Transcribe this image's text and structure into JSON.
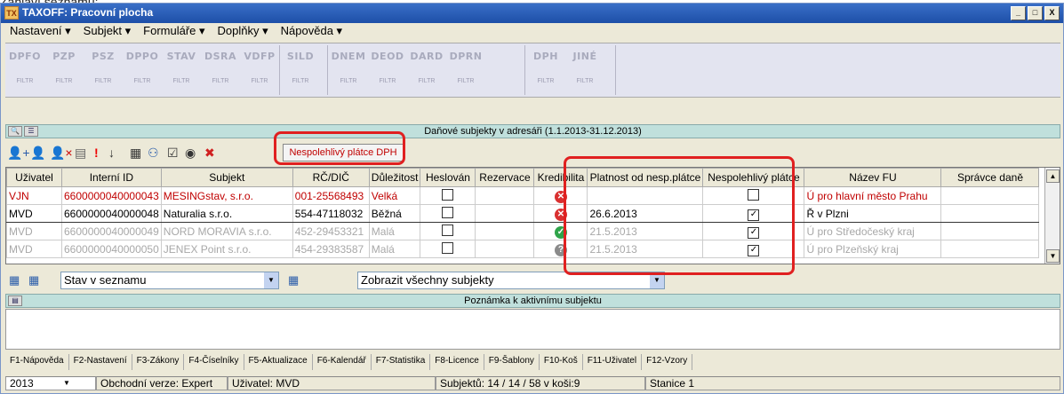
{
  "caption": "Zahlaví seznamu:",
  "window": {
    "title": "TAXOFF: Pracovní plocha",
    "icon": "app-icon",
    "buttons": [
      "_",
      "□",
      "X"
    ]
  },
  "menu": [
    {
      "label": "Nastavení ▾"
    },
    {
      "label": "Subjekt ▾"
    },
    {
      "label": "Formuláře ▾"
    },
    {
      "label": "Doplňky ▾"
    },
    {
      "label": "Nápověda ▾"
    }
  ],
  "forms": [
    {
      "label": "DPFO",
      "sub": "FILTR"
    },
    {
      "label": "PZP",
      "sub": "FILTR"
    },
    {
      "label": "PSZ",
      "sub": "FILTR"
    },
    {
      "label": "DPPO",
      "sub": "FILTR"
    },
    {
      "label": "STAV",
      "sub": "FILTR"
    },
    {
      "label": "DSRA",
      "sub": "FILTR"
    },
    {
      "label": "VDFP",
      "sub": "FILTR"
    },
    {
      "label": "SILD",
      "sub": "FILTR"
    },
    {
      "label": "DNEM",
      "sub": "FILTR"
    },
    {
      "label": "DEOD",
      "sub": "FILTR"
    },
    {
      "label": "DARD",
      "sub": "FILTR"
    },
    {
      "label": "DPRN",
      "sub": "FILTR"
    },
    {
      "label": "DPH",
      "sub": "FILTR"
    },
    {
      "label": "JINÉ",
      "sub": "FILTR"
    }
  ],
  "address_bar": {
    "text": "Daňové subjekty v adresáři (1.1.2013-31.12.2013)"
  },
  "toolbar": {
    "unreliable_button": "Nespolehlivý plátce DPH"
  },
  "table": {
    "columns": [
      "Uživatel",
      "Interní ID",
      "Subjekt",
      "RČ/DIČ",
      "Důležitost",
      "Heslován",
      "Rezervace",
      "Kredibilita",
      "Platnost od nesp.plátce",
      "Nespolehlivý plátce",
      "Název FU",
      "Správce daně"
    ],
    "rows": [
      {
        "user": "VJN",
        "id": "6600000040000043",
        "subject": "MESINGstav, s.r.o.",
        "dic": "001-25568493",
        "importance": "Velká",
        "password": false,
        "credibility": "error",
        "valid_from": "",
        "unreliable": false,
        "fu": "Ú pro hlavní město Prahu",
        "admin": ""
      },
      {
        "user": "MVD",
        "id": "6600000040000048",
        "subject": "Naturalia s.r.o.",
        "dic": "554-47118032",
        "importance": "Běžná",
        "password": false,
        "credibility": "error",
        "valid_from": "26.6.2013",
        "unreliable": true,
        "fu": "Ř v Plzni",
        "admin": ""
      },
      {
        "user": "MVD",
        "id": "6600000040000049",
        "subject": "NORD MORAVIA s.r.o.",
        "dic": "452-29453321",
        "importance": "Malá",
        "password": false,
        "credibility": "ok",
        "valid_from": "21.5.2013",
        "unreliable": true,
        "fu": "Ú pro Středočeský kraj",
        "admin": ""
      },
      {
        "user": "MVD",
        "id": "6600000040000050",
        "subject": "JENEX Point s.r.o.",
        "dic": "454-29383587",
        "importance": "Malá",
        "password": false,
        "credibility": "unknown",
        "valid_from": "21.5.2013",
        "unreliable": true,
        "fu": "Ú pro Plzeňský kraj",
        "admin": ""
      }
    ]
  },
  "filters": {
    "state": "Stav v seznamu",
    "show": "Zobrazit všechny subjekty"
  },
  "note_bar": {
    "text": "Poznámka k aktivnímu subjektu"
  },
  "fkeys": [
    "F1-Nápověda",
    "F2-Nastavení",
    "F3-Zákony",
    "F4-Číselníky",
    "F5-Aktualizace",
    "F6-Kalendář",
    "F7-Statistika",
    "F8-Licence",
    "F9-Šablony",
    "F10-Koš",
    "F11-Uživatel",
    "F12-Vzory"
  ],
  "status": {
    "year": "2013",
    "version": "Obchodní verze: Expert",
    "user": "Uživatel: MVD",
    "subjects": "Subjektů: 14 / 14 / 58   v koši:9",
    "station": "Stanice 1"
  },
  "colors": {
    "accent_red": "#e02020",
    "header_teal": "#c0e0dc",
    "title_blue": "#1d4fa8"
  }
}
